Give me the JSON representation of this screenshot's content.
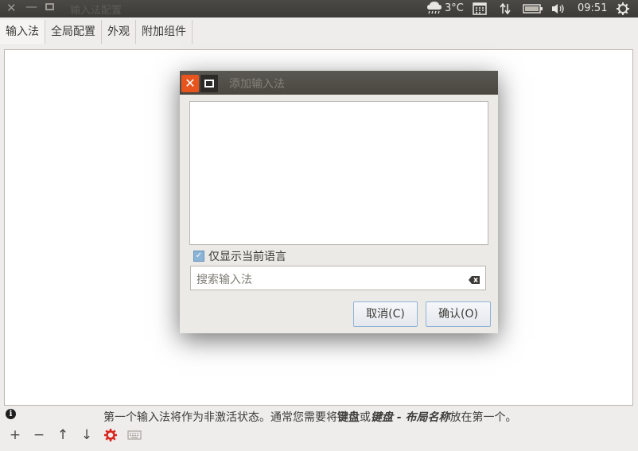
{
  "topbar": {
    "close_glyph": "✕",
    "minimize_glyph": "—",
    "window_title": "输入法配置",
    "weather_icon": "cloud-rain-icon",
    "temperature": "3°C",
    "time": "09:51"
  },
  "tabs": [
    "输入法",
    "全局配置",
    "外观",
    "附加组件"
  ],
  "bottom": {
    "info_text_parts": [
      "第一个输入法将作为非激活状态。通常您需要将",
      "键盘",
      "或",
      "键盘 - 布局名称",
      "放在第一个。"
    ],
    "tools": [
      "+",
      "−",
      "↑",
      "↓"
    ]
  },
  "dialog": {
    "title": "添加输入法",
    "close_glyph": "✕",
    "checkbox_label": "仅显示当前语言",
    "checkbox_checked": true,
    "search_placeholder": "搜索输入法",
    "cancel_label": "取消(C)",
    "ok_label": "确认(O)"
  },
  "colors": {
    "panel": "#3c3b37",
    "close_accent": "#e7541d",
    "button_border": "#8fb2d8",
    "gear_icon": "#d9251d"
  }
}
